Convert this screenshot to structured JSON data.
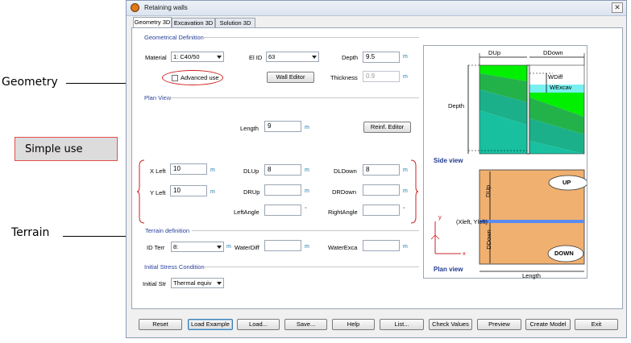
{
  "annotations": {
    "geometry": "Geometry",
    "simple_use": "Simple use",
    "terrain": "Terrain"
  },
  "window": {
    "title": "Retaining walls",
    "close": "✕"
  },
  "tabs": [
    "Geometry 3D",
    "Excavation 3D",
    "Solution 3D"
  ],
  "geometrical_definition": {
    "title": "Geometrical Definition",
    "material_label": "Material",
    "material_value": "1: C40/50",
    "el_id_label": "El ID",
    "el_id_value": "63",
    "depth_label": "Depth",
    "depth_value": "9.5",
    "depth_unit": "m",
    "advanced_label": "Advanced use",
    "wall_editor": "Wall Editor",
    "thickness_label": "Thickness",
    "thickness_value": "0.9",
    "thickness_unit": "m"
  },
  "plan_view": {
    "title": "Plan View",
    "length_label": "Length",
    "length_value": "9",
    "length_unit": "m",
    "reinf_editor": "Reinf. Editor",
    "x_left_label": "X Left",
    "x_left_value": "10",
    "y_left_label": "Y Left",
    "y_left_value": "10",
    "unit_m": "m",
    "dlup_label": "DLUp",
    "dlup_value": "8",
    "dldown_label": "DLDown",
    "dldown_value": "8",
    "drup_label": "DRUp",
    "drup_value": "",
    "drdown_label": "DRDown",
    "drdown_value": "",
    "left_angle_label": "LeftAngle",
    "left_angle_value": "",
    "right_angle_label": "RightAngle",
    "right_angle_value": "",
    "unit_deg": "°"
  },
  "terrain_definition": {
    "title": "Terrain definition",
    "id_terr_label": "ID Terr",
    "id_terr_value": "8:",
    "water_diff_label": "WaterDiff",
    "water_diff_value": "",
    "water_exca_label": "WaterExca",
    "water_exca_value": ""
  },
  "initial_stress": {
    "title": "Initial Stress Condition",
    "initial_str_label": "Initial Str",
    "initial_str_value": "Thermal equiv"
  },
  "diagram": {
    "dup": "DUp",
    "ddown": "DDown",
    "depth": "Depth",
    "wdiff": "WDiff",
    "wexcav": "WExcav",
    "side_view": "Side view",
    "up": "UP",
    "down": "DOWN",
    "dup_vertical": "DUp",
    "ddown_vertical": "DDown",
    "origin": "(Xleft, Yleft)",
    "axis_x": "x",
    "axis_y": "y",
    "plan_view": "Plan view",
    "length": "Length",
    "colors": {
      "green_bright": "#00f000",
      "green_mid": "#23b24a",
      "teal": "#18c0a0",
      "cyan_light": "#78f0f0",
      "cyan": "#00e0d8",
      "sand": "#f0b070",
      "blue_line": "#5a8af0"
    }
  },
  "footer": {
    "reset": "Reset",
    "load_example": "Load Example",
    "load": "Load...",
    "save": "Save...",
    "help": "Help",
    "list": "List...",
    "check_values": "Check Values",
    "preview": "Preview",
    "create_model": "Create Model",
    "exit": "Exit"
  }
}
